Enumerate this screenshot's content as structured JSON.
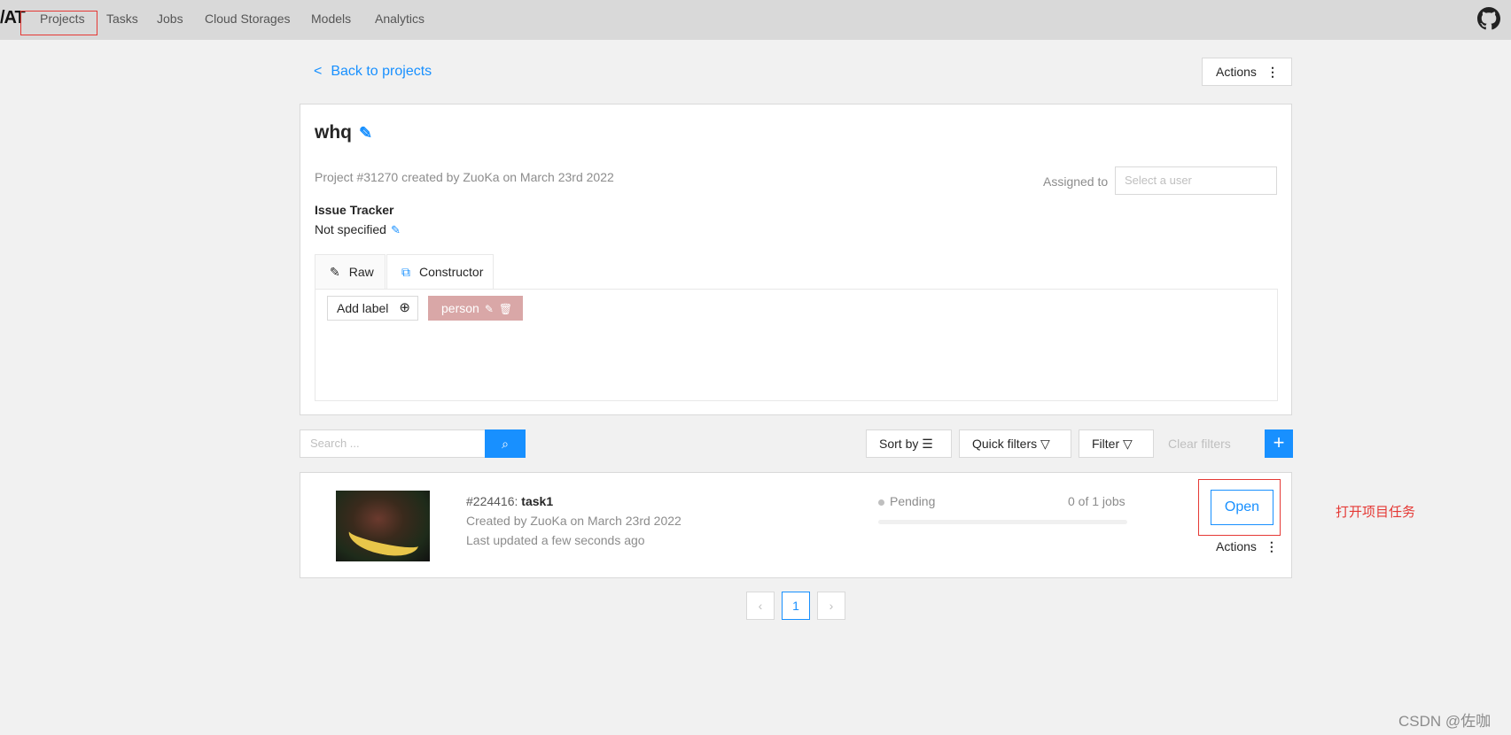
{
  "header": {
    "logo": "/AT",
    "nav": [
      {
        "label": "Projects"
      },
      {
        "label": "Tasks"
      },
      {
        "label": "Jobs"
      },
      {
        "label": "Cloud Storages"
      },
      {
        "label": "Models"
      },
      {
        "label": "Analytics"
      }
    ],
    "github_icon": "github-icon"
  },
  "page": {
    "back_label": "Back to projects",
    "actions_label": "Actions"
  },
  "project": {
    "name": "whq",
    "meta": "Project #31270 created by ZuoKa on March 23rd 2022",
    "assigned_label": "Assigned to",
    "assigned_placeholder": "Select a user",
    "issue_tracker_title": "Issue Tracker",
    "issue_tracker_value": "Not specified",
    "tabs": [
      {
        "label": "Raw"
      },
      {
        "label": "Constructor"
      }
    ],
    "active_tab": "Constructor",
    "add_label": "Add label",
    "labels": [
      {
        "name": "person",
        "color": "#d9a7a7"
      }
    ]
  },
  "toolbar": {
    "search_placeholder": "Search ...",
    "sort_label": "Sort by",
    "quick_filters_label": "Quick filters",
    "filter_label": "Filter",
    "clear_filters_label": "Clear filters"
  },
  "task": {
    "id": "#224416:",
    "name": "task1",
    "created": "Created by ZuoKa on March 23rd 2022",
    "updated": "Last updated a few seconds ago",
    "status": "Pending",
    "jobs": "0 of 1 jobs",
    "progress": 0,
    "open_label": "Open",
    "actions_label": "Actions"
  },
  "pagination": {
    "current": "1"
  },
  "annotation": "打开项目任务",
  "watermark": "CSDN @佐咖",
  "colors": {
    "accent": "#1890ff",
    "annotation": "#e53935",
    "label_person": "#d9a7a7"
  }
}
